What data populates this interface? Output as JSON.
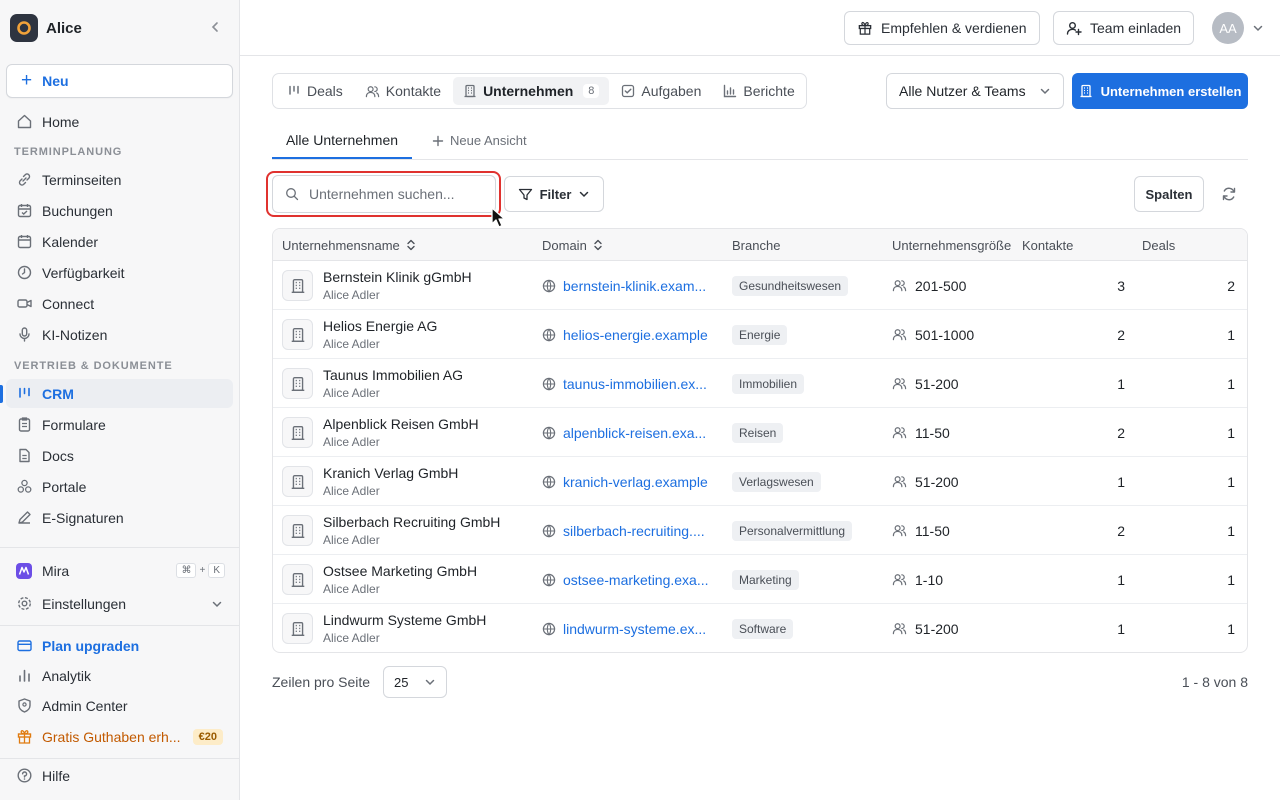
{
  "workspace": {
    "name": "Alice"
  },
  "sidebar": {
    "new_label": "Neu",
    "home": "Home",
    "section_scheduling": "TERMINPLANUNG",
    "scheduling_items": [
      "Terminseiten",
      "Buchungen",
      "Kalender",
      "Verfügbarkeit",
      "Connect",
      "KI-Notizen"
    ],
    "section_sales": "VERTRIEB & DOKUMENTE",
    "sales_items": [
      "CRM",
      "Formulare",
      "Docs",
      "Portale",
      "E-Signaturen"
    ],
    "mira": "Mira",
    "mira_shortcut": [
      "⌘",
      "+",
      "K"
    ],
    "settings": "Einstellungen",
    "upgrade": "Plan upgraden",
    "analytics": "Analytik",
    "admin": "Admin Center",
    "credit": "Gratis Guthaben erh...",
    "credit_badge": "€20",
    "help": "Hilfe"
  },
  "topbar": {
    "refer": "Empfehlen & verdienen",
    "invite": "Team einladen",
    "avatar": "AA"
  },
  "tabs": [
    {
      "label": "Deals",
      "icon": "pipeline-icon"
    },
    {
      "label": "Kontakte",
      "icon": "contacts-icon"
    },
    {
      "label": "Unternehmen",
      "icon": "building-icon",
      "count": "8",
      "active": true
    },
    {
      "label": "Aufgaben",
      "icon": "task-icon"
    },
    {
      "label": "Berichte",
      "icon": "chart-icon"
    }
  ],
  "users_filter": "Alle Nutzer & Teams",
  "create_button": "Unternehmen erstellen",
  "views": {
    "active": "Alle Unternehmen",
    "new": "Neue Ansicht"
  },
  "search": {
    "placeholder": "Unternehmen suchen..."
  },
  "filter_label": "Filter",
  "columns_label": "Spalten",
  "table": {
    "headers": [
      "Unternehmensname",
      "Domain",
      "Branche",
      "Unternehmensgröße",
      "Kontakte",
      "Deals"
    ],
    "rows": [
      {
        "name": "Bernstein Klinik gGmbH",
        "owner": "Alice Adler",
        "domain": "bernstein-klinik.exam...",
        "industry": "Gesundheitswesen",
        "size": "201-500",
        "contacts": "3",
        "deals": "2"
      },
      {
        "name": "Helios Energie AG",
        "owner": "Alice Adler",
        "domain": "helios-energie.example",
        "industry": "Energie",
        "size": "501-1000",
        "contacts": "2",
        "deals": "1"
      },
      {
        "name": "Taunus Immobilien AG",
        "owner": "Alice Adler",
        "domain": "taunus-immobilien.ex...",
        "industry": "Immobilien",
        "size": "51-200",
        "contacts": "1",
        "deals": "1"
      },
      {
        "name": "Alpenblick Reisen GmbH",
        "owner": "Alice Adler",
        "domain": "alpenblick-reisen.exa...",
        "industry": "Reisen",
        "size": "11-50",
        "contacts": "2",
        "deals": "1"
      },
      {
        "name": "Kranich Verlag GmbH",
        "owner": "Alice Adler",
        "domain": "kranich-verlag.example",
        "industry": "Verlagswesen",
        "size": "51-200",
        "contacts": "1",
        "deals": "1"
      },
      {
        "name": "Silberbach Recruiting GmbH",
        "owner": "Alice Adler",
        "domain": "silberbach-recruiting....",
        "industry": "Personalvermittlung",
        "size": "11-50",
        "contacts": "2",
        "deals": "1"
      },
      {
        "name": "Ostsee Marketing GmbH",
        "owner": "Alice Adler",
        "domain": "ostsee-marketing.exa...",
        "industry": "Marketing",
        "size": "1-10",
        "contacts": "1",
        "deals": "1"
      },
      {
        "name": "Lindwurm Systeme GmbH",
        "owner": "Alice Adler",
        "domain": "lindwurm-systeme.ex...",
        "industry": "Software",
        "size": "51-200",
        "contacts": "1",
        "deals": "1"
      }
    ]
  },
  "pagination": {
    "rows_label": "Zeilen pro Seite",
    "rows_value": "25",
    "info": "1 - 8 von 8"
  },
  "colors": {
    "accent": "#1d6fe0",
    "highlight": "#e0322f",
    "credit": "#c25a00"
  }
}
